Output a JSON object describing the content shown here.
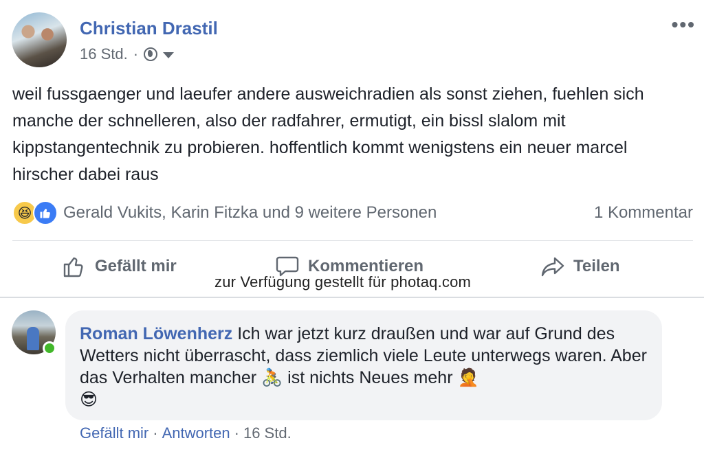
{
  "post": {
    "author": "Christian Drastil",
    "time": "16 Std.",
    "separator": "·",
    "more_label": "•••",
    "text": "weil fussgaenger und laeufer andere ausweichradien als sonst ziehen, fuehlen sich manche der schnelleren, also der radfahrer, ermutigt, ein bissl slalom mit kippstangentechnik zu probieren. hoffentlich kommt wenigstens ein neuer marcel hirscher dabei raus",
    "reactions": {
      "icons": [
        "haha-emoji",
        "like-icon"
      ],
      "names": "Gerald Vukits, Karin Fitzka und 9 weitere Personen",
      "comment_count": "1 Kommentar"
    },
    "actions": {
      "like": "Gefällt mir",
      "comment": "Kommentieren",
      "share": "Teilen"
    }
  },
  "watermark": "zur Verfügung gestellt für photaq.com",
  "comment": {
    "author": "Roman Löwenherz",
    "text_part1": " Ich war jetzt kurz draußen und war auf Grund des Wetters nicht überrascht, dass ziemlich viele Leute unterwegs waren. Aber das Verhalten mancher ",
    "emoji_bike": "🚴",
    "text_part2": " ist nichts Neues mehr ",
    "emoji_facepalm": "🤦",
    "emoji_cool": "😎",
    "footer": {
      "like": "Gefällt mir",
      "sep1": "·",
      "reply": "Antworten",
      "sep2": "·",
      "time": "16 Std."
    }
  },
  "colors": {
    "link_blue": "#4267b2",
    "text": "#1d2129",
    "muted": "#606770",
    "bubble": "#f2f3f5",
    "online": "#42b72a"
  }
}
